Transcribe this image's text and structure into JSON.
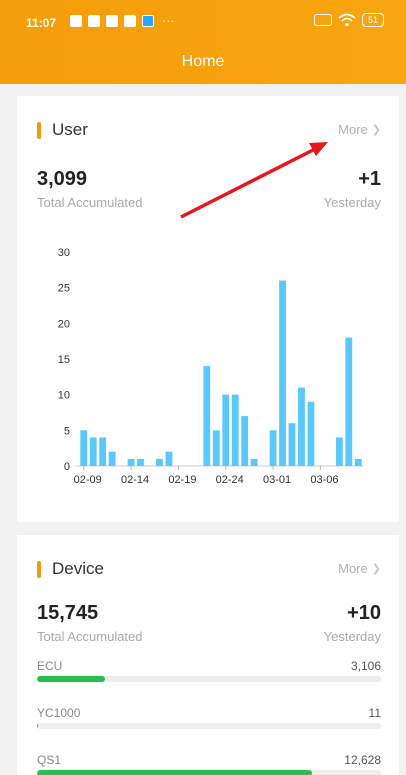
{
  "status": {
    "time": "11:07",
    "dots": "···",
    "battery": "51"
  },
  "header": {
    "title": "Home"
  },
  "user_card": {
    "title": "User",
    "more": "More",
    "total": "3,099",
    "total_label": "Total Accumulated",
    "delta": "+1",
    "delta_label": "Yesterday"
  },
  "chart_data": {
    "type": "bar",
    "categories": [
      "02-09",
      "02-10",
      "02-11",
      "02-12",
      "02-13",
      "02-14",
      "02-15",
      "02-16",
      "02-17",
      "02-18",
      "02-19",
      "02-20",
      "02-21",
      "02-22",
      "02-23",
      "02-24",
      "02-25",
      "02-26",
      "02-27",
      "02-28",
      "03-01",
      "03-02",
      "03-03",
      "03-04",
      "03-05",
      "03-06",
      "03-07",
      "03-08",
      "03-09",
      "03-10"
    ],
    "values": [
      5,
      4,
      4,
      2,
      0,
      1,
      1,
      0,
      1,
      2,
      0,
      0,
      0,
      14,
      5,
      10,
      10,
      7,
      1,
      0,
      5,
      26,
      6,
      11,
      9,
      0,
      0,
      4,
      18,
      1
    ],
    "xticks": [
      "02-09",
      "02-14",
      "02-19",
      "02-24",
      "03-01",
      "03-06"
    ],
    "yticks": [
      0,
      5,
      10,
      15,
      20,
      25,
      30
    ],
    "ylim": [
      0,
      30
    ],
    "color": "#5ac8fa"
  },
  "device_card": {
    "title": "Device",
    "more": "More",
    "total": "15,745",
    "total_label": "Total Accumulated",
    "delta": "+10",
    "delta_label": "Yesterday",
    "rows": [
      {
        "name": "ECU",
        "value": "3,106",
        "fraction": 0.197
      },
      {
        "name": "YC1000",
        "value": "11",
        "fraction": 0.0007
      },
      {
        "name": "QS1",
        "value": "12,628",
        "fraction": 0.8
      }
    ],
    "bar_color": "#27c04f"
  },
  "colors": {
    "brand": "#f7a20c",
    "accent": "#f39a0a",
    "annotation": "#e8161b"
  }
}
